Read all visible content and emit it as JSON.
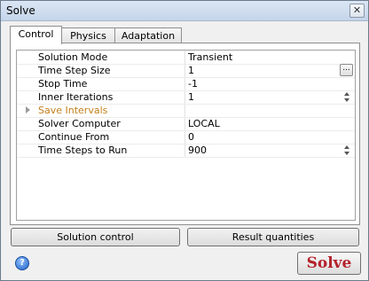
{
  "window": {
    "title": "Solve",
    "close_label": "✕"
  },
  "tabs": [
    {
      "label": "Control",
      "active": true
    },
    {
      "label": "Physics",
      "active": false
    },
    {
      "label": "Adaptation",
      "active": false
    }
  ],
  "properties": [
    {
      "label": "Solution Mode",
      "value": "Transient"
    },
    {
      "label": "Time Step Size",
      "value": "1"
    },
    {
      "label": "Stop Time",
      "value": "-1"
    },
    {
      "label": "Inner Iterations",
      "value": "1"
    },
    {
      "label": "Save Intervals",
      "value": ""
    },
    {
      "label": "Solver Computer",
      "value": "LOCAL"
    },
    {
      "label": "Continue From",
      "value": "0"
    },
    {
      "label": "Time Steps to Run",
      "value": "900"
    }
  ],
  "buttons": {
    "solution_control": "Solution control",
    "result_quantities": "Result quantities",
    "solve": "Solve",
    "help_icon_glyph": "?",
    "ellipsis": "..."
  },
  "colors": {
    "group_label": "#c47f1a",
    "solve_text": "#b3222b"
  }
}
